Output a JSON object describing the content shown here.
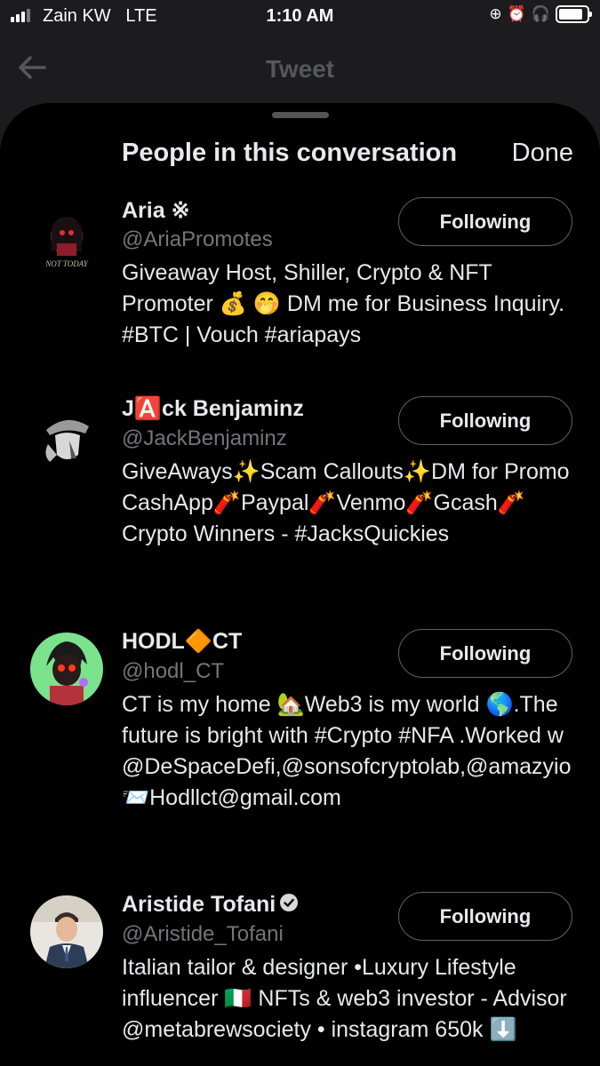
{
  "status_bar": {
    "carrier": "Zain KW",
    "network": "LTE",
    "time": "1:10 AM"
  },
  "nav": {
    "title": "Tweet"
  },
  "sheet": {
    "title": "People in this conversation",
    "done_label": "Done"
  },
  "people": [
    {
      "name": "Aria",
      "name_suffix": "※",
      "handle": "@AriaPromotes",
      "follow_label": "Following",
      "bio": "Giveaway Host, Shiller, Crypto & NFT Promoter 💰 🤭 DM me for Business Inquiry. #BTC | Vouch #ariapays"
    },
    {
      "name_prefix": "J",
      "name_emoji": "🅰️",
      "name": "ck Benjaminz",
      "handle": "@JackBenjaminz",
      "follow_label": "Following",
      "bio": "GiveAways✨Scam Callouts✨DM for Promo CashApp🧨Paypal🧨Venmo🧨Gcash🧨Crypto Winners - #JacksQuickies"
    },
    {
      "name_prefix": "HODL",
      "name_emoji": "🔶",
      "name": "CT",
      "handle": "@hodl_CT",
      "follow_label": "Following",
      "bio": "CT is my home 🏡Web3 is my world 🌎.The future is bright with #Crypto #NFA .Worked w @DeSpaceDefi,@sonsofcryptolab,@amazyio 📨Hodllct@gmail.com"
    },
    {
      "name": "Aristide Tofani",
      "verified": true,
      "handle": "@Aristide_Tofani",
      "follow_label": "Following",
      "bio": "Italian tailor & designer •Luxury Lifestyle influencer 🇮🇹 NFTs & web3 investor - Advisor @metabrewsociety • instagram 650k ⬇️"
    }
  ]
}
